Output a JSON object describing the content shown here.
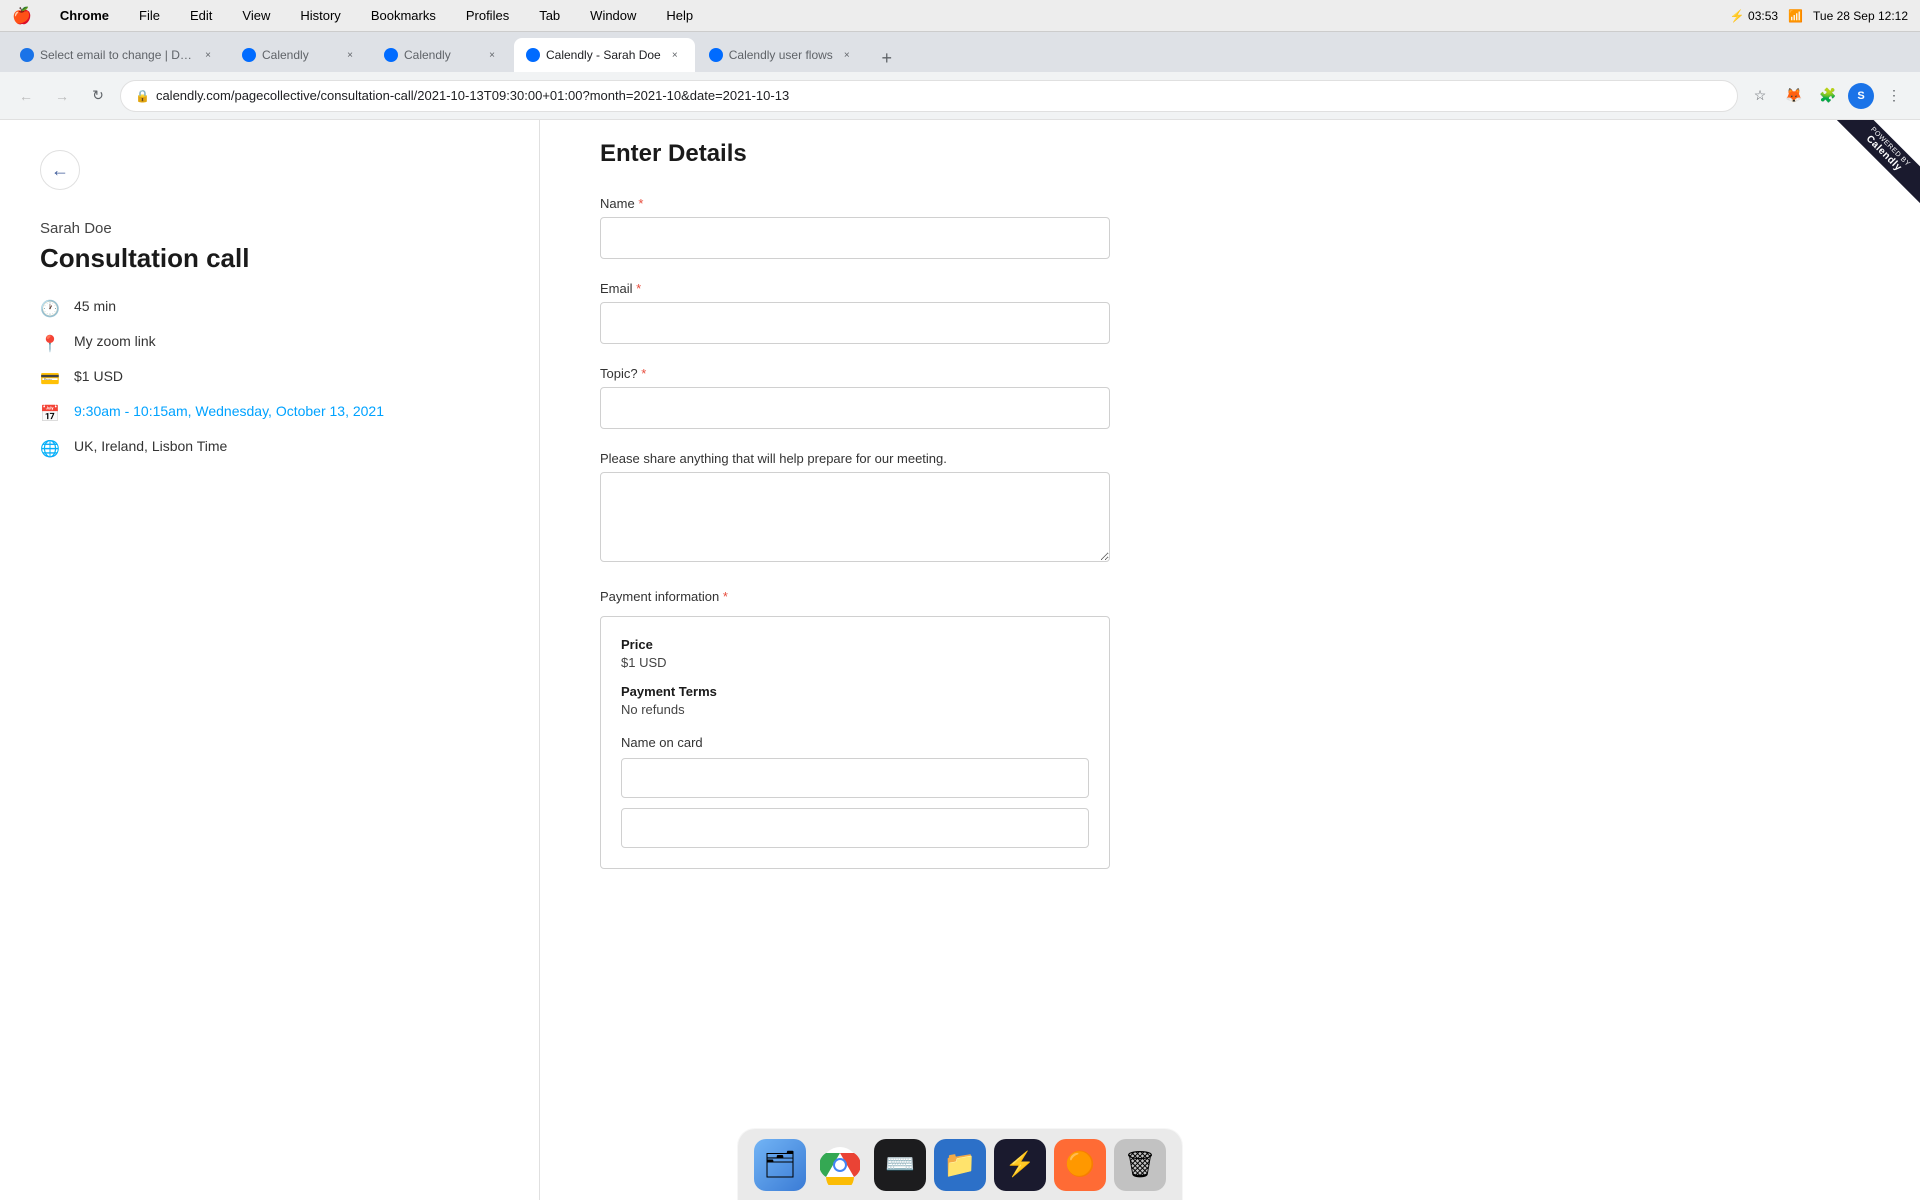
{
  "menuBar": {
    "apple": "🍎",
    "items": [
      "Chrome",
      "File",
      "Edit",
      "View",
      "History",
      "Bookmarks",
      "Profiles",
      "Tab",
      "Window",
      "Help"
    ],
    "rightItems": {
      "battery": "⚡",
      "time": "Tue 28 Sep  12:12"
    }
  },
  "tabs": [
    {
      "id": "tab1",
      "label": "Select email to change | Djang...",
      "active": false,
      "favicon": "🔵"
    },
    {
      "id": "tab2",
      "label": "Calendly",
      "active": false,
      "favicon": "🟢"
    },
    {
      "id": "tab3",
      "label": "Calendly",
      "active": false,
      "favicon": "🟢"
    },
    {
      "id": "tab4",
      "label": "Calendly - Sarah Doe",
      "active": true,
      "favicon": "🟢"
    },
    {
      "id": "tab5",
      "label": "Calendly user flows",
      "active": false,
      "favicon": "🟢"
    }
  ],
  "addressBar": {
    "url": "calendly.com/pagecollective/consultation-call/2021-10-13T09:30:00+01:00?month=2021-10&date=2021-10-13"
  },
  "leftPanel": {
    "userName": "Sarah Doe",
    "eventTitle": "Consultation call",
    "duration": "45 min",
    "location": "My zoom link",
    "price": "$1 USD",
    "dateTime": "9:30am - 10:15am, Wednesday, October 13, 2021",
    "timezone": "UK, Ireland, Lisbon Time"
  },
  "form": {
    "title": "Enter Details",
    "nameLabel": "Name",
    "emailLabel": "Email",
    "topicLabel": "Topic?",
    "topicQuestionLabel": "Please share anything that will help prepare for our meeting.",
    "paymentLabel": "Payment information",
    "required": "*",
    "payment": {
      "priceLabel": "Price",
      "priceValue": "$1 USD",
      "termsLabel": "Payment Terms",
      "termsValue": "No refunds",
      "cardNameLabel": "Name on card"
    }
  },
  "watermark": {
    "powered": "POWERED BY",
    "brand": "Calendly"
  },
  "dock": {
    "items": [
      {
        "name": "finder",
        "emoji": "🗂️"
      },
      {
        "name": "chrome",
        "emoji": "🌐"
      },
      {
        "name": "terminal",
        "emoji": "🖥️"
      },
      {
        "name": "files",
        "emoji": "📁"
      },
      {
        "name": "topnotch",
        "emoji": "⚡"
      },
      {
        "name": "app6",
        "emoji": "🟡"
      },
      {
        "name": "trash",
        "emoji": "🗑️"
      }
    ]
  }
}
